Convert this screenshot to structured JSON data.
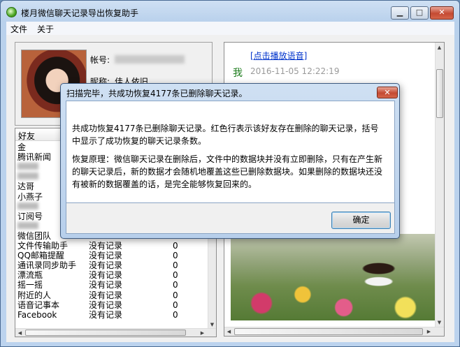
{
  "window": {
    "title": "楼月微信聊天记录导出恢复助手"
  },
  "titlebar_buttons": {
    "minimize": "▁",
    "maximize": "□",
    "close": "✕"
  },
  "menu": [
    "文件",
    "关于"
  ],
  "profile": {
    "account_label": "帐号:",
    "nickname_label": "昵称:",
    "nickname_partial": "佳人依旧"
  },
  "friends": {
    "headers": [
      "好友"
    ],
    "rows": [
      {
        "name": "金",
        "status": "",
        "count": ""
      },
      {
        "name": "腾讯新闻",
        "status": "",
        "count": ""
      },
      {
        "name": "",
        "status": "",
        "count": ""
      },
      {
        "name": "",
        "status": "",
        "count": ""
      },
      {
        "name": "达哥",
        "status": "",
        "count": ""
      },
      {
        "name": "小燕子",
        "status": "",
        "count": ""
      },
      {
        "name": "",
        "status": "",
        "count": ""
      },
      {
        "name": "订阅号",
        "status": "",
        "count": ""
      },
      {
        "name": "",
        "status": "",
        "count": ""
      },
      {
        "name": "微信团队",
        "status": "",
        "count": ""
      },
      {
        "name": "文件传输助手",
        "status": "没有记录",
        "count": "0"
      },
      {
        "name": "QQ邮箱提醒",
        "status": "没有记录",
        "count": "0"
      },
      {
        "name": "通讯录同步助手",
        "status": "没有记录",
        "count": "0"
      },
      {
        "name": "漂流瓶",
        "status": "没有记录",
        "count": "0"
      },
      {
        "name": "摇一摇",
        "status": "没有记录",
        "count": "0"
      },
      {
        "name": "附近的人",
        "status": "没有记录",
        "count": "0"
      },
      {
        "name": "语音记事本",
        "status": "没有记录",
        "count": "0"
      },
      {
        "name": "Facebook",
        "status": "没有记录",
        "count": "0"
      }
    ]
  },
  "chat": {
    "audio_link": "[点击播放语音]",
    "sender": "我",
    "timestamp": "2016-11-05 12:22:19"
  },
  "dialog": {
    "title": "扫描完毕，共成功恢复4177条已删除聊天记录。",
    "close": "✕",
    "paragraph1": "共成功恢复4177条已删除聊天记录。红色行表示该好友存在删除的聊天记录，括号中显示了成功恢复的聊天记录条数。",
    "paragraph2": "恢复原理：微信聊天记录在删除后，文件中的数据块并没有立即删除，只有在产生新的聊天记录后，新的数据才会随机地覆盖这些已删除数据块。如果删除的数据块还没有被新的数据覆盖的话，是完全能够恢复回来的。",
    "ok_label": "确定"
  }
}
